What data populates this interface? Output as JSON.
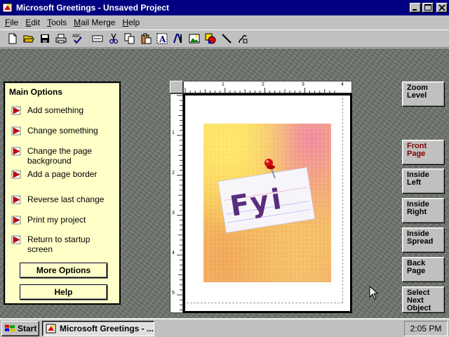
{
  "window": {
    "title": "Microsoft Greetings - Unsaved Project",
    "buttons": {
      "minimize": "_",
      "maximize": "□",
      "close": "×"
    }
  },
  "menu": {
    "items": [
      {
        "label_ul": "F",
        "label_rest": "ile"
      },
      {
        "label_ul": "E",
        "label_rest": "dit"
      },
      {
        "label_ul": "T",
        "label_rest": "ools"
      },
      {
        "label_ul": "M",
        "label_rest": "ail Merge"
      },
      {
        "label_ul": "H",
        "label_rest": "elp"
      }
    ]
  },
  "toolbar": {
    "icons": [
      "new-file-icon",
      "open-folder-icon",
      "save-icon",
      "print-icon",
      "spell-check-icon",
      "text-frame-icon",
      "cut-icon",
      "copy-icon",
      "paste-icon",
      "text-box-icon",
      "word-art-icon",
      "picture-icon",
      "shapes-icon",
      "line-icon",
      "link-icon"
    ]
  },
  "options_panel": {
    "title": "Main Options",
    "items": [
      {
        "label": "Add something"
      },
      {
        "label": "Change something"
      },
      {
        "label": "Change the page background"
      },
      {
        "label": "Add a page border"
      },
      {
        "label": "Reverse last change"
      },
      {
        "label": "Print my project"
      },
      {
        "label": "Return to startup screen"
      }
    ],
    "more_options_label": "More Options",
    "help_label": "Help"
  },
  "ruler": {
    "top_numbers": [
      "1",
      "2",
      "3",
      "4"
    ],
    "left_numbers": [
      "1",
      "2",
      "3",
      "4",
      "5"
    ]
  },
  "artwork": {
    "text": "Fyi"
  },
  "navigation": {
    "zoom_label": "Zoom Level",
    "pages": [
      {
        "label": "Front Page",
        "active": true
      },
      {
        "label": "Inside Left",
        "active": false
      },
      {
        "label": "Inside Right",
        "active": false
      },
      {
        "label": "Inside Spread",
        "active": false
      },
      {
        "label": "Back Page",
        "active": false
      },
      {
        "label": "Select Next Object",
        "active": false
      }
    ]
  },
  "taskbar": {
    "start_label": "Start",
    "task_label": "Microsoft Greetings - ...",
    "clock": "2:05 PM"
  },
  "colors": {
    "titlebar": "#000080",
    "panel_bg": "#ffffc8",
    "active_page_text": "#800000",
    "workspace": "#6f756e"
  }
}
